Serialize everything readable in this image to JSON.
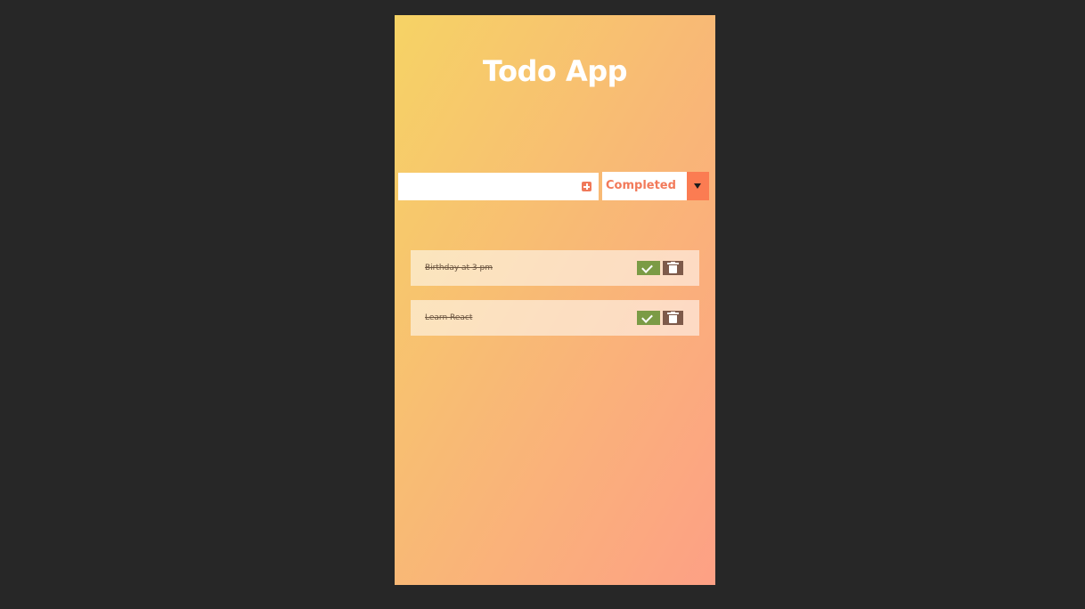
{
  "app": {
    "title": "Todo App"
  },
  "form": {
    "input_value": "",
    "add_icon": "plus-square-icon",
    "filter": {
      "selected": "Completed",
      "arrow_icon": "caret-down-icon"
    }
  },
  "todos": [
    {
      "text": "Birthday at 3 pm",
      "completed": true
    },
    {
      "text": "Learn React",
      "completed": true
    }
  ],
  "colors": {
    "page_background": "#272727",
    "gradient_start": "#f6d365",
    "gradient_end": "#fda085",
    "accent": "#f27a5a",
    "complete_button": "#7b9b45",
    "trash_button": "#7e5a4a"
  }
}
